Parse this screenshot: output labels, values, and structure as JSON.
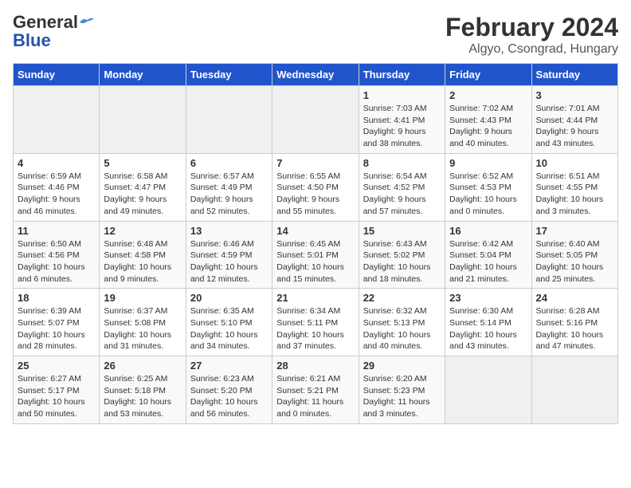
{
  "header": {
    "logo_line1": "General",
    "logo_line2": "Blue",
    "title": "February 2024",
    "subtitle": "Algyo, Csongrad, Hungary"
  },
  "weekdays": [
    "Sunday",
    "Monday",
    "Tuesday",
    "Wednesday",
    "Thursday",
    "Friday",
    "Saturday"
  ],
  "weeks": [
    [
      {
        "day": "",
        "info": ""
      },
      {
        "day": "",
        "info": ""
      },
      {
        "day": "",
        "info": ""
      },
      {
        "day": "",
        "info": ""
      },
      {
        "day": "1",
        "info": "Sunrise: 7:03 AM\nSunset: 4:41 PM\nDaylight: 9 hours\nand 38 minutes."
      },
      {
        "day": "2",
        "info": "Sunrise: 7:02 AM\nSunset: 4:43 PM\nDaylight: 9 hours\nand 40 minutes."
      },
      {
        "day": "3",
        "info": "Sunrise: 7:01 AM\nSunset: 4:44 PM\nDaylight: 9 hours\nand 43 minutes."
      }
    ],
    [
      {
        "day": "4",
        "info": "Sunrise: 6:59 AM\nSunset: 4:46 PM\nDaylight: 9 hours\nand 46 minutes."
      },
      {
        "day": "5",
        "info": "Sunrise: 6:58 AM\nSunset: 4:47 PM\nDaylight: 9 hours\nand 49 minutes."
      },
      {
        "day": "6",
        "info": "Sunrise: 6:57 AM\nSunset: 4:49 PM\nDaylight: 9 hours\nand 52 minutes."
      },
      {
        "day": "7",
        "info": "Sunrise: 6:55 AM\nSunset: 4:50 PM\nDaylight: 9 hours\nand 55 minutes."
      },
      {
        "day": "8",
        "info": "Sunrise: 6:54 AM\nSunset: 4:52 PM\nDaylight: 9 hours\nand 57 minutes."
      },
      {
        "day": "9",
        "info": "Sunrise: 6:52 AM\nSunset: 4:53 PM\nDaylight: 10 hours\nand 0 minutes."
      },
      {
        "day": "10",
        "info": "Sunrise: 6:51 AM\nSunset: 4:55 PM\nDaylight: 10 hours\nand 3 minutes."
      }
    ],
    [
      {
        "day": "11",
        "info": "Sunrise: 6:50 AM\nSunset: 4:56 PM\nDaylight: 10 hours\nand 6 minutes."
      },
      {
        "day": "12",
        "info": "Sunrise: 6:48 AM\nSunset: 4:58 PM\nDaylight: 10 hours\nand 9 minutes."
      },
      {
        "day": "13",
        "info": "Sunrise: 6:46 AM\nSunset: 4:59 PM\nDaylight: 10 hours\nand 12 minutes."
      },
      {
        "day": "14",
        "info": "Sunrise: 6:45 AM\nSunset: 5:01 PM\nDaylight: 10 hours\nand 15 minutes."
      },
      {
        "day": "15",
        "info": "Sunrise: 6:43 AM\nSunset: 5:02 PM\nDaylight: 10 hours\nand 18 minutes."
      },
      {
        "day": "16",
        "info": "Sunrise: 6:42 AM\nSunset: 5:04 PM\nDaylight: 10 hours\nand 21 minutes."
      },
      {
        "day": "17",
        "info": "Sunrise: 6:40 AM\nSunset: 5:05 PM\nDaylight: 10 hours\nand 25 minutes."
      }
    ],
    [
      {
        "day": "18",
        "info": "Sunrise: 6:39 AM\nSunset: 5:07 PM\nDaylight: 10 hours\nand 28 minutes."
      },
      {
        "day": "19",
        "info": "Sunrise: 6:37 AM\nSunset: 5:08 PM\nDaylight: 10 hours\nand 31 minutes."
      },
      {
        "day": "20",
        "info": "Sunrise: 6:35 AM\nSunset: 5:10 PM\nDaylight: 10 hours\nand 34 minutes."
      },
      {
        "day": "21",
        "info": "Sunrise: 6:34 AM\nSunset: 5:11 PM\nDaylight: 10 hours\nand 37 minutes."
      },
      {
        "day": "22",
        "info": "Sunrise: 6:32 AM\nSunset: 5:13 PM\nDaylight: 10 hours\nand 40 minutes."
      },
      {
        "day": "23",
        "info": "Sunrise: 6:30 AM\nSunset: 5:14 PM\nDaylight: 10 hours\nand 43 minutes."
      },
      {
        "day": "24",
        "info": "Sunrise: 6:28 AM\nSunset: 5:16 PM\nDaylight: 10 hours\nand 47 minutes."
      }
    ],
    [
      {
        "day": "25",
        "info": "Sunrise: 6:27 AM\nSunset: 5:17 PM\nDaylight: 10 hours\nand 50 minutes."
      },
      {
        "day": "26",
        "info": "Sunrise: 6:25 AM\nSunset: 5:18 PM\nDaylight: 10 hours\nand 53 minutes."
      },
      {
        "day": "27",
        "info": "Sunrise: 6:23 AM\nSunset: 5:20 PM\nDaylight: 10 hours\nand 56 minutes."
      },
      {
        "day": "28",
        "info": "Sunrise: 6:21 AM\nSunset: 5:21 PM\nDaylight: 11 hours\nand 0 minutes."
      },
      {
        "day": "29",
        "info": "Sunrise: 6:20 AM\nSunset: 5:23 PM\nDaylight: 11 hours\nand 3 minutes."
      },
      {
        "day": "",
        "info": ""
      },
      {
        "day": "",
        "info": ""
      }
    ]
  ]
}
